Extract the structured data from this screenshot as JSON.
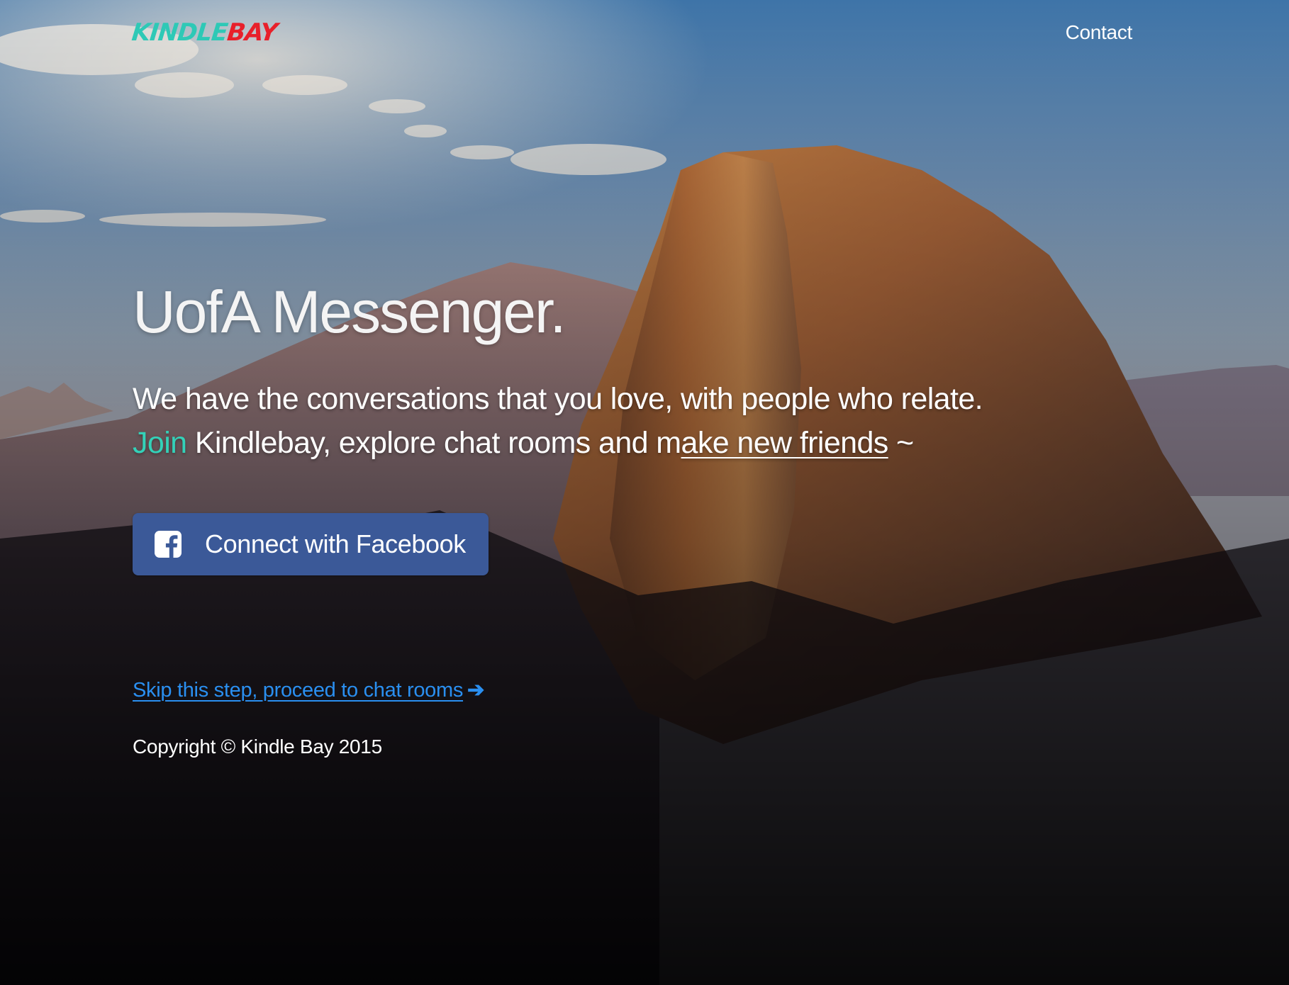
{
  "navbar": {
    "brand_part1": "KINDLE",
    "brand_part2": "BAY",
    "contact_label": "Contact"
  },
  "hero": {
    "title": "UofA Messenger.",
    "tagline_line1": "We have the conversations that you love, with people who relate.",
    "tagline_join": "Join",
    "tagline_line2_mid": " Kindlebay, explore chat rooms and m",
    "tagline_line2_underlined": "ake new friends",
    "tagline_line2_end": " ~",
    "facebook_button_label": "Connect with Facebook",
    "facebook_icon": "facebook-square-icon"
  },
  "links": {
    "skip_label": "Skip this step, proceed to chat rooms",
    "skip_arrow": "➔",
    "skip_icon": "arrow-right-icon"
  },
  "footer": {
    "copyright": "Copyright © Kindle Bay 2015"
  },
  "colors": {
    "brand_teal": "#2ec9b6",
    "brand_red": "#e8202a",
    "join_accent": "#33d1b8",
    "facebook_blue": "#3b5998",
    "link_blue": "#2a8ff0"
  }
}
